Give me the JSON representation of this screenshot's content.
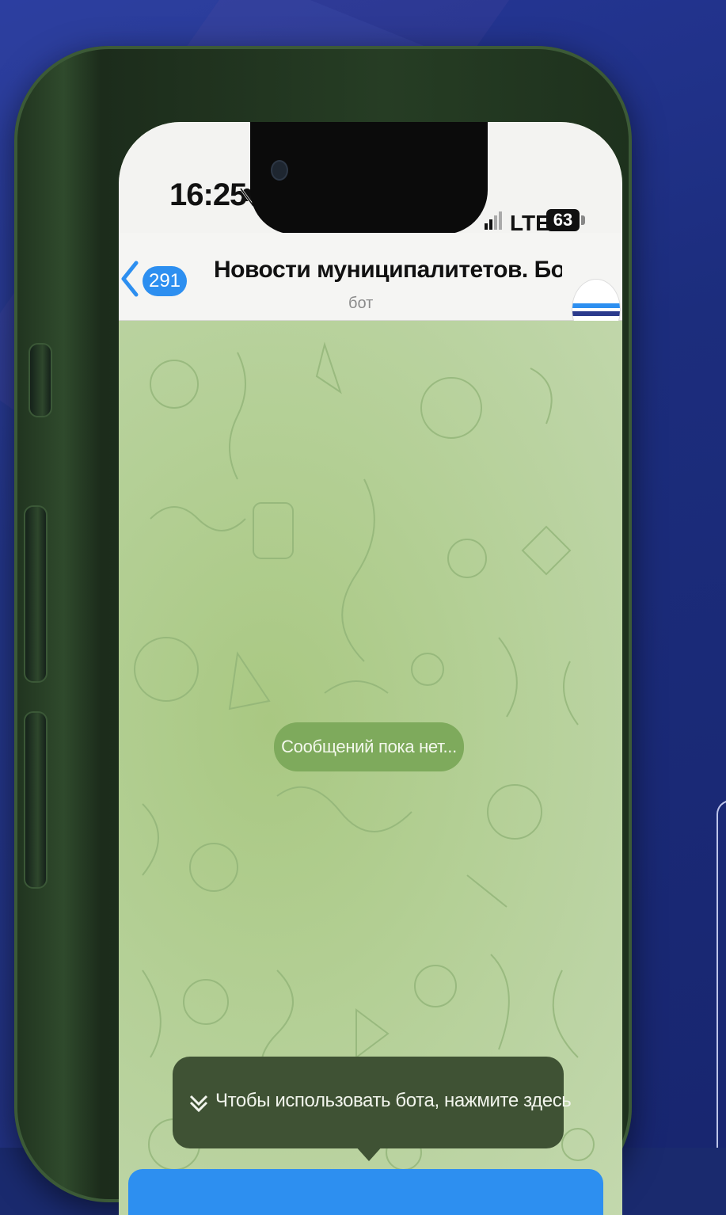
{
  "status_bar": {
    "time": "16:25",
    "network": "LTE",
    "battery": "63"
  },
  "chat_header": {
    "back_count": "291",
    "title": "Новости муниципалитетов. Бот-...",
    "subtitle": "бот"
  },
  "chat": {
    "empty_state": "Сообщений пока нет..."
  },
  "tooltip": {
    "text": "Чтобы использовать бота, нажмите здесь"
  },
  "colors": {
    "accent": "#2d8ff0",
    "background": "#1c2d7d",
    "phone_frame": "#263d24",
    "chat_wallpaper": "#b3cf94"
  }
}
